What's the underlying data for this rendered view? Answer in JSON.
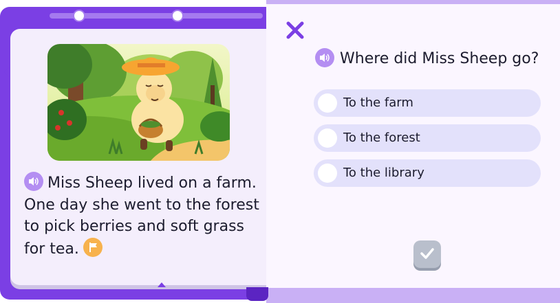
{
  "colors": {
    "frame": "#7b3fe4",
    "page": "#f4eefc",
    "audio_button": "#b48ef2",
    "flag_button": "#f7b24d",
    "option_background": "#e3e1fb",
    "check_button": "#b9bfcc",
    "close_icon": "#7b3fe4"
  },
  "progress": {
    "dots": 2
  },
  "story": {
    "line1": "Miss Sheep lived on a farm.",
    "line2": "One day she went to the forest",
    "line3": "to pick berries and soft grass",
    "line4": "for tea.",
    "audio_icon": "speaker-icon",
    "flag_icon": "flag-icon"
  },
  "question": {
    "text": "Where did Miss Sheep go?",
    "audio_icon": "speaker-icon"
  },
  "options": [
    {
      "label": "To the farm"
    },
    {
      "label": "To the forest"
    },
    {
      "label": "To the library"
    }
  ],
  "controls": {
    "close_icon": "close-icon",
    "check_icon": "checkmark-icon"
  }
}
